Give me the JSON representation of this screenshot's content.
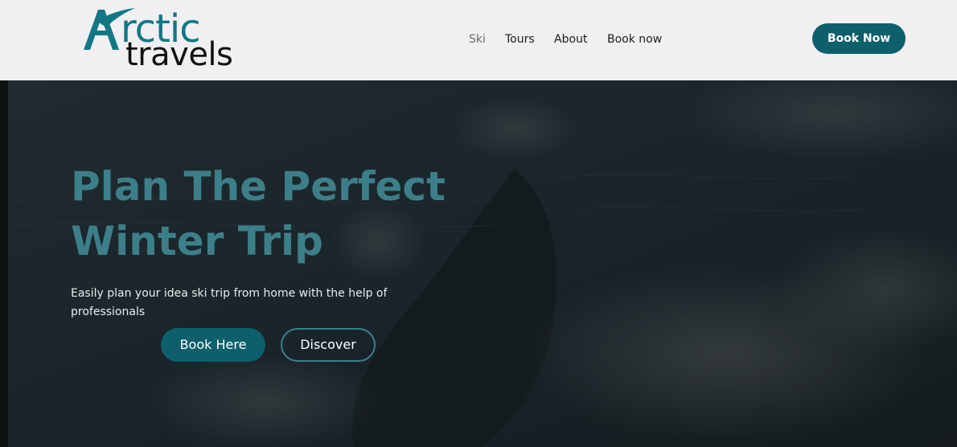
{
  "logo": {
    "word_top": "Arctic",
    "word_top_first": "A",
    "word_top_rest": "rctic",
    "word_bottom": "travels",
    "brand_color": "#127785"
  },
  "nav": {
    "items": [
      {
        "label": "Ski"
      },
      {
        "label": "Tours"
      },
      {
        "label": "About"
      },
      {
        "label": "Book now"
      }
    ]
  },
  "header": {
    "cta_label": "Book Now"
  },
  "hero": {
    "title_line1": "Plan The Perfect",
    "title_line2": "Winter Trip",
    "subtitle": "Easily plan your idea ski trip from home with the help of professionals",
    "primary_button": "Book Here",
    "secondary_button": "Discover"
  },
  "colors": {
    "accent": "#0e5f6c",
    "title": "#3d7f88",
    "header_bg": "#f0eff2"
  }
}
